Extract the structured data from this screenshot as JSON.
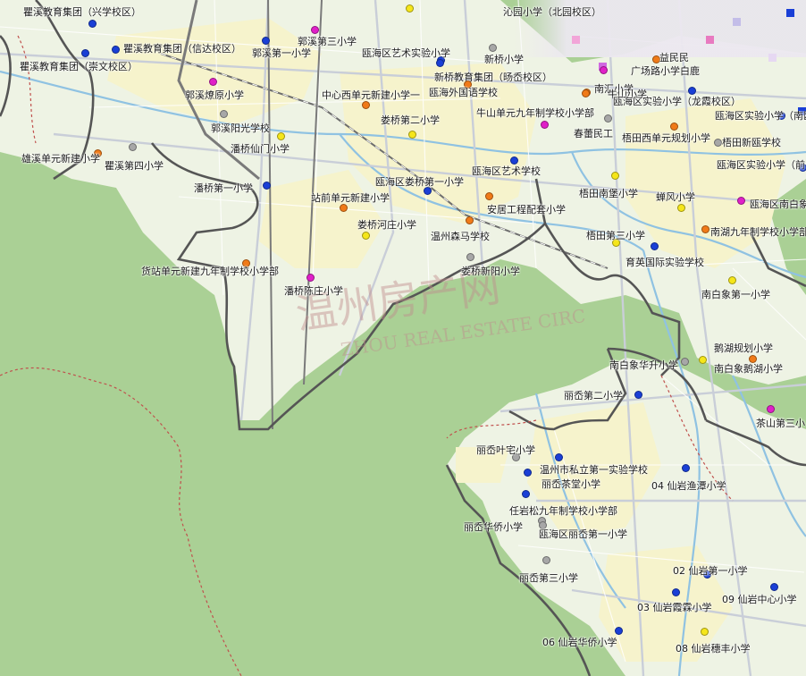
{
  "watermark": {
    "cn": "温州房产网",
    "en": "ZHOU REAL ESTATE CIRC"
  },
  "legend_colors": {
    "blue": "#1a3fd6",
    "orange": "#f07a18",
    "yellow": "#f5e61a",
    "magenta": "#e020c8",
    "gray": "#a7a7a7",
    "district_boundary": "#555555",
    "mountain": "#a9cf94",
    "urban": "#f7f5d2",
    "river": "#9ec9e6"
  },
  "schools": [
    {
      "name": "瞿溪教育集团（兴学校区）",
      "color": "blue"
    },
    {
      "name": "瞿溪教育集团（信达校区）",
      "color": "blue"
    },
    {
      "name": "瞿溪教育集团（崇文校区）",
      "color": "blue"
    },
    {
      "name": "郭溪第三小学",
      "color": "magenta"
    },
    {
      "name": "郭溪第一小学",
      "color": "blue"
    },
    {
      "name": "瓯海区艺术实验小学",
      "color": "blue"
    },
    {
      "name": "沁园小学（北园校区）",
      "color": "yellow"
    },
    {
      "name": "新桥小学",
      "color": "gray"
    },
    {
      "name": "新桥教育集团（旸岙校区）",
      "color": "blue"
    },
    {
      "name": "益民民",
      "color": "orange"
    },
    {
      "name": "广场路小学白鹿",
      "color": "magenta"
    },
    {
      "name": "郭溪燎原小学",
      "color": "magenta"
    },
    {
      "name": "中心西单元新建小学一",
      "color": "orange"
    },
    {
      "name": "瓯海外国语学校",
      "color": "orange"
    },
    {
      "name": "南汇小学",
      "color": "orange"
    },
    {
      "name": "牛山小学",
      "color": "orange"
    },
    {
      "name": "瓯海区实验小学（龙霞校区）",
      "color": "blue"
    },
    {
      "name": "郭溪阳光学校",
      "color": "gray"
    },
    {
      "name": "娄桥第二小学",
      "color": "yellow"
    },
    {
      "name": "牛山单元九年制学校小学部",
      "color": "magenta"
    },
    {
      "name": "春蕾民工",
      "color": "gray"
    },
    {
      "name": "瓯海区实验小学（南瓯校区）",
      "color": "blue"
    },
    {
      "name": "潘桥仙门小学",
      "color": "yellow"
    },
    {
      "name": "梧田西单元规划小学",
      "color": "orange"
    },
    {
      "name": "梧田新瓯学校",
      "color": "gray"
    },
    {
      "name": "雄溪单元新建小学",
      "color": "orange"
    },
    {
      "name": "瞿溪第四小学",
      "color": "gray"
    },
    {
      "name": "瓯海区实验小学（前",
      "color": "blue"
    },
    {
      "name": "瓯海区艺术学校",
      "color": "blue"
    },
    {
      "name": "瓯海区娄桥第一小学",
      "color": "blue"
    },
    {
      "name": "潘桥第一小学",
      "color": "blue"
    },
    {
      "name": "站前单元新建小学",
      "color": "orange"
    },
    {
      "name": "梧田南堡小学",
      "color": "yellow"
    },
    {
      "name": "蝉风小学",
      "color": "yellow"
    },
    {
      "name": "瓯海区南白象",
      "color": "magenta"
    },
    {
      "name": "安居工程配套小学",
      "color": "orange"
    },
    {
      "name": "娄桥河庄小学",
      "color": "yellow"
    },
    {
      "name": "温州森马学校",
      "color": "orange"
    },
    {
      "name": "梧田第三小学",
      "color": "yellow"
    },
    {
      "name": "南湖九年制学校小学部",
      "color": "orange"
    },
    {
      "name": "育英国际实验学校",
      "color": "blue"
    },
    {
      "name": "娄桥新阳小学",
      "color": "gray"
    },
    {
      "name": "货站单元新建九年制学校小学部",
      "color": "orange"
    },
    {
      "name": "潘桥陈庄小学",
      "color": "magenta"
    },
    {
      "name": "南白象第一小学",
      "color": "yellow"
    },
    {
      "name": "鹅湖规划小学",
      "color": "orange"
    },
    {
      "name": "南白象华升小学",
      "color": "gray"
    },
    {
      "name": "南白象鹅湖小学",
      "color": "yellow"
    },
    {
      "name": "丽岙第二小学",
      "color": "blue"
    },
    {
      "name": "茶山第三小",
      "color": "magenta"
    },
    {
      "name": "丽岙叶宅小学",
      "color": "gray"
    },
    {
      "name": "温州市私立第一实验学校",
      "color": "blue"
    },
    {
      "name": "04 仙岩渔潭小学",
      "color": "blue"
    },
    {
      "name": "丽岙茶堂小学",
      "color": "blue"
    },
    {
      "name": "任岩松九年制学校小学部",
      "color": "blue"
    },
    {
      "name": "丽岙华侨小学",
      "color": "gray"
    },
    {
      "name": "瓯海区丽岙第一小学",
      "color": "gray"
    },
    {
      "name": "丽岙第三小学",
      "color": "gray"
    },
    {
      "name": "02 仙岩第一小学",
      "color": "blue"
    },
    {
      "name": "09 仙岩中心小学",
      "color": "blue"
    },
    {
      "name": "03 仙岩霞霖小学",
      "color": "blue"
    },
    {
      "name": "06 仙岩华侨小学",
      "color": "blue"
    },
    {
      "name": "08 仙岩穗丰小学",
      "color": "yellow"
    }
  ]
}
